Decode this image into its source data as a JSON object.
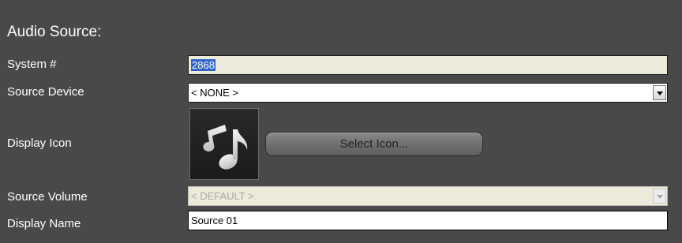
{
  "section_title": "Audio Source:",
  "labels": {
    "system_num": "System #",
    "source_device": "Source Device",
    "display_icon": "Display Icon",
    "source_volume": "Source Volume",
    "display_name": "Display Name"
  },
  "fields": {
    "system_num_value": "2868",
    "source_device_value": "< NONE >",
    "source_volume_value": "< DEFAULT >",
    "display_name_value": "Source 01"
  },
  "buttons": {
    "select_icon": "Select Icon..."
  },
  "icons": {
    "display_icon": "music-note-icon"
  },
  "colors": {
    "background": "#494949",
    "readonly_field": "#ecead8",
    "selection": "#3264c8",
    "disabled_text": "#a8a8a8"
  }
}
